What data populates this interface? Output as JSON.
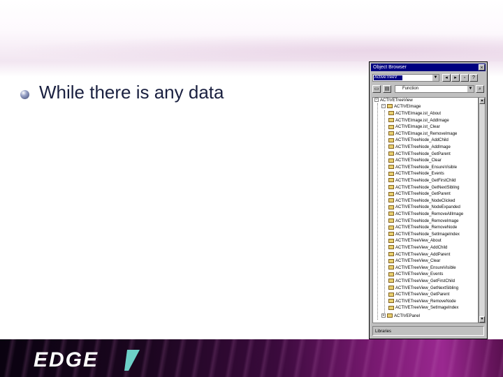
{
  "slide": {
    "bullet_text": "While there is any data"
  },
  "object_browser": {
    "title": "Object Browser",
    "library_combo_value": "ActiveTreeV",
    "search_combo_value": "Function",
    "tree_root": "ACTIVETreeView",
    "tree_group": "ACTIVEImage",
    "tree_items": [
      "ACTIVEImage.ist_About",
      "ACTIVEImage.ist_AddImage",
      "ACTIVEImage.ist_Clear",
      "ACTIVEImage.ist_RemoveImage",
      "ACTIVETreeNode_AddChild",
      "ACTIVETreeNode_AddImage",
      "ACTIVETreeNode_GetParent",
      "ACTIVETreeNode_Clear",
      "ACTIVETreeNode_EnsureVisible",
      "ACTIVETreeNode_Events",
      "ACTIVETreeNode_GetFirstChild",
      "ACTIVETreeNode_GetNextSibling",
      "ACTIVETreeNode_GetParent",
      "ACTIVETreeNode_NodeClicked",
      "ACTIVETreeNode_NodeExpanded",
      "ACTIVETreeNode_RemoveAllImage",
      "ACTIVETreeNode_RemoveImage",
      "ACTIVETreeNode_RemoveNode",
      "ACTIVETreeNode_SetImageIndex",
      "ACTIVETreeView_About",
      "ACTIVETreeView_AddChild",
      "ACTIVETreeView_AddParent",
      "ACTIVETreeView_Clear",
      "ACTIVETreeView_EnsureVisible",
      "ACTIVETreeView_Events",
      "ACTIVETreeView_GetFirstChild",
      "ACTIVETreeView_GetNextSibling",
      "ACTIVETreeView_GetParent",
      "ACTIVETreeView_RemoveNode",
      "ACTIVETreeView_SetImageIndex"
    ],
    "tree_last": "ACTIVEPanel",
    "status_text": "Libraries"
  },
  "footer": {
    "logo_text": "EDGE"
  },
  "colors": {
    "titlebar": "#000080",
    "bullet_text": "#1a2040",
    "footer_accent": "#9a2890"
  },
  "icons": {
    "bullet": "sphere-bullet-icon",
    "close": "close-icon",
    "dropdown": "chevron-down-icon",
    "folder": "folder-icon",
    "expand": "expand-box-icon"
  }
}
